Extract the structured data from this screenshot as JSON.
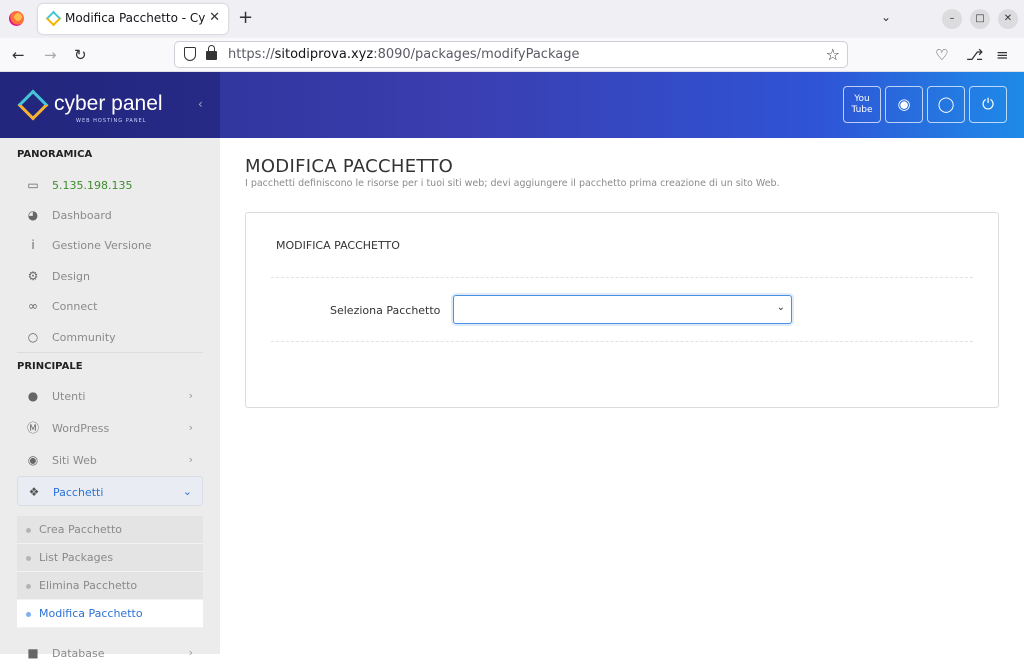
{
  "browser": {
    "tab_title": "Modifica Pacchetto - CyberPanel",
    "tab_close": "✕",
    "new_tab": "+",
    "url_host": "sitodiprova.xyz",
    "url_prefix": "https://",
    "url_rest": ":8090/packages/modifyPackage"
  },
  "header": {
    "brand_name": "cyber panel",
    "brand_sub": "WEB HOSTING PANEL",
    "buttons": [
      "youtube-icon",
      "chat-icon",
      "support-icon",
      "power-icon"
    ]
  },
  "sidebar": {
    "section_overview": "PANORAMICA",
    "ip_address": "5.135.198.135",
    "overview_items": [
      {
        "label": "Dashboard",
        "icon": "dashboard-icon"
      },
      {
        "label": "Gestione Versione",
        "icon": "info-icon"
      },
      {
        "label": "Design",
        "icon": "gear-icon"
      },
      {
        "label": "Connect",
        "icon": "link-icon"
      },
      {
        "label": "Community",
        "icon": "comments-icon"
      }
    ],
    "section_main": "PRINCIPALE",
    "main_items": [
      {
        "label": "Utenti",
        "icon": "users-icon"
      },
      {
        "label": "WordPress",
        "icon": "wordpress-icon"
      },
      {
        "label": "Siti Web",
        "icon": "globe-icon"
      },
      {
        "label": "Pacchetti",
        "icon": "cubes-icon"
      }
    ],
    "package_sub_items": [
      {
        "label": "Crea Pacchetto"
      },
      {
        "label": "List Packages"
      },
      {
        "label": "Elimina Pacchetto"
      },
      {
        "label": "Modifica Pacchetto"
      }
    ],
    "next_item": "Database"
  },
  "main": {
    "title": "MODIFICA PACCHETTO",
    "description": "I pacchetti definiscono le risorse per i tuoi siti web; devi aggiungere il pacchetto prima creazione di un sito Web.",
    "panel_title": "MODIFICA PACCHETTO",
    "select_label": "Seleziona Pacchetto",
    "select_value": ""
  },
  "colors": {
    "header_start": "#2a2e8f",
    "header_end": "#1e8be8",
    "active": "#2b72d6",
    "ip_green": "#3d8b2f"
  }
}
